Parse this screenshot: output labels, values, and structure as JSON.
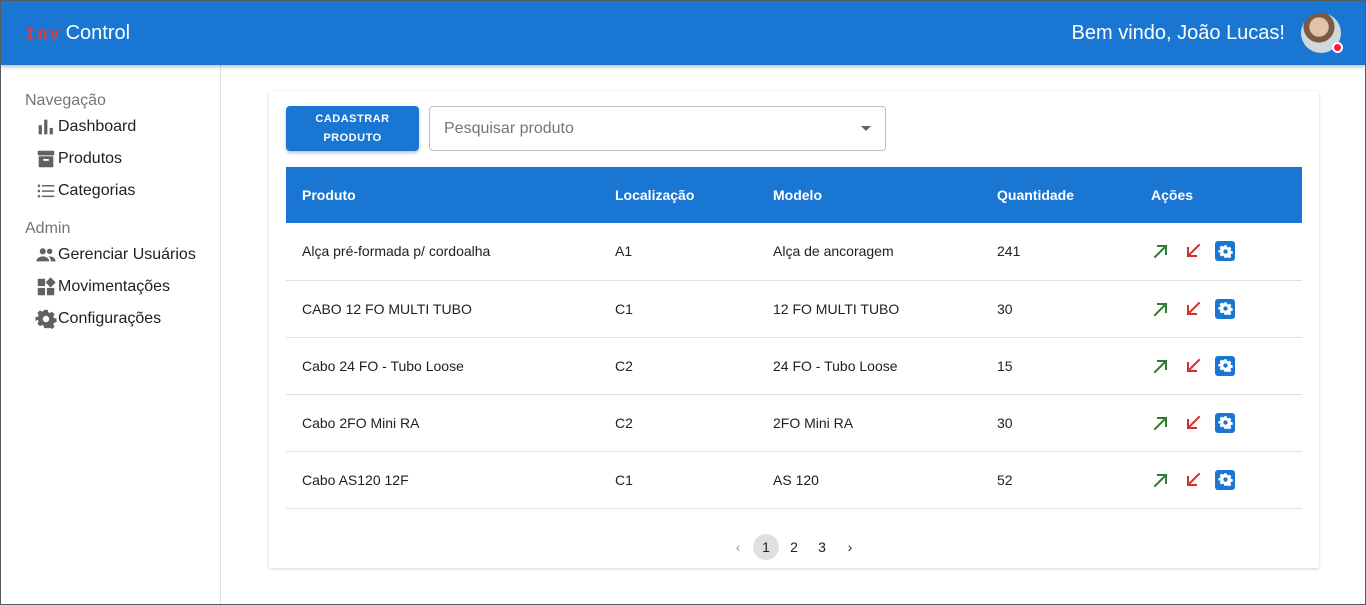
{
  "header": {
    "brand_inv": "Inv",
    "brand_control": "Control",
    "welcome": "Bem vindo, João Lucas!"
  },
  "sidebar": {
    "sections": [
      {
        "title": "Navegação",
        "items": [
          {
            "label": "Dashboard",
            "icon": "bar-chart-icon"
          },
          {
            "label": "Produtos",
            "icon": "archive-icon"
          },
          {
            "label": "Categorias",
            "icon": "list-icon"
          }
        ]
      },
      {
        "title": "Admin",
        "items": [
          {
            "label": "Gerenciar Usuários",
            "icon": "people-icon"
          },
          {
            "label": "Movimentações",
            "icon": "widgets-icon"
          },
          {
            "label": "Configurações",
            "icon": "gear-icon"
          }
        ]
      }
    ]
  },
  "toolbar": {
    "add_button_label": "CADASTRAR PRODUTO",
    "search_placeholder": "Pesquisar produto"
  },
  "table": {
    "columns": [
      "Produto",
      "Localização",
      "Modelo",
      "Quantidade",
      "Ações"
    ],
    "rows": [
      [
        "Alça pré-formada p/ cordoalha",
        "A1",
        "Alça de ancoragem",
        "241"
      ],
      [
        "CABO 12 FO MULTI TUBO",
        "C1",
        "12 FO MULTI TUBO",
        "30"
      ],
      [
        "Cabo 24 FO - Tubo Loose",
        "C2",
        "24 FO - Tubo Loose",
        "15"
      ],
      [
        "Cabo 2FO Mini RA",
        "C2",
        "2FO Mini RA",
        "30"
      ],
      [
        "Cabo AS120 12F",
        "C1",
        "AS 120",
        "52"
      ]
    ]
  },
  "pagination": {
    "pages": [
      "1",
      "2",
      "3"
    ],
    "current": "1"
  },
  "colors": {
    "primary": "#1976d2",
    "entry": "#2e7d32",
    "exit": "#d32f2f",
    "brand_accent": "#e53935"
  }
}
